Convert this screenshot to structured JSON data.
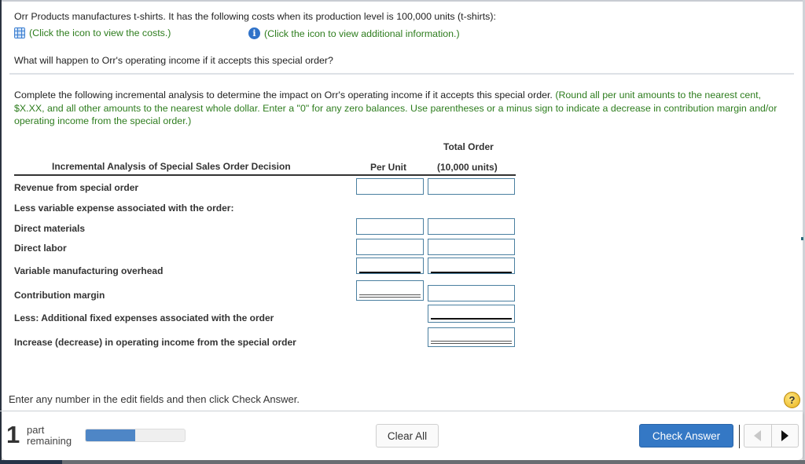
{
  "problem": {
    "intro": "Orr Products manufactures t-shirts. It has the following costs when its production level is 100,000 units (t-shirts):",
    "costs_link": "(Click the icon to view the costs.)",
    "costs_icon": "table-grid-icon",
    "info_link": "(Click the icon to view additional information.)",
    "info_icon": "info-icon",
    "question": "What will happen to Orr's operating income if it accepts this special order?"
  },
  "instructions": {
    "main": "Complete the following incremental analysis to determine the impact on Orr's operating income if it accepts this special order.",
    "hint": "(Round all per unit amounts to the nearest cent, $X.XX, and all other amounts to the nearest whole dollar. Enter a \"0\" for any zero balances. Use parentheses or a minus sign to indicate a decrease in contribution margin and/or operating income from the special order.)"
  },
  "table": {
    "title": "Incremental Analysis of Special Sales Order Decision",
    "col_per_unit": "Per Unit",
    "col_total_line1": "Total Order",
    "col_total_line2": "(10,000 units)",
    "rows": [
      {
        "label": "Revenue from special order",
        "per_unit": "",
        "total": ""
      },
      {
        "label": "Less variable expense associated with the order:"
      },
      {
        "label": "Direct materials",
        "per_unit": "",
        "total": ""
      },
      {
        "label": "Direct labor",
        "per_unit": "",
        "total": ""
      },
      {
        "label": "Variable manufacturing overhead",
        "per_unit": "",
        "total": ""
      },
      {
        "label": "Contribution margin",
        "per_unit": "",
        "total": ""
      },
      {
        "label": "Less: Additional fixed expenses associated with the order",
        "total": ""
      },
      {
        "label": "Increase (decrease) in operating income from the special order",
        "total": ""
      }
    ]
  },
  "footer": {
    "hint": "Enter any number in the edit fields and then click Check Answer.",
    "help_icon": "?",
    "parts_count": "1",
    "parts_label_1": "part",
    "parts_label_2": "remaining",
    "progress_fraction": 0.5,
    "clear_all": "Clear All",
    "check_answer": "Check Answer"
  },
  "colors": {
    "accent_green": "#2e7d1e",
    "button_blue": "#3478c5",
    "input_border": "#4a7fa0",
    "progress_fill": "#4e86c6"
  }
}
